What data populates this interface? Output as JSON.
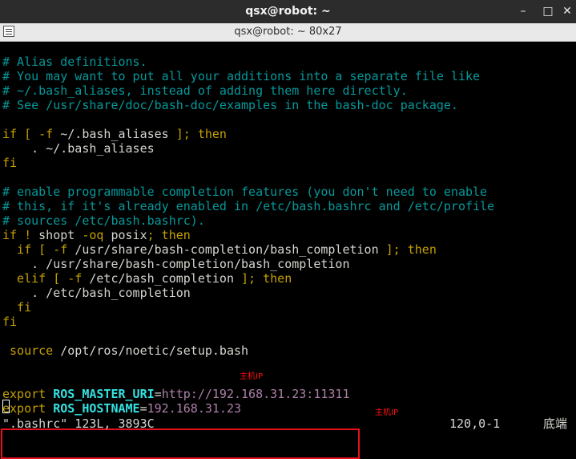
{
  "window": {
    "title": "qsx@robot: ~",
    "buttons": {
      "minimize": "–",
      "maximize": "□",
      "close": "✕"
    }
  },
  "tab": {
    "title": "qsx@robot: ~ 80x27"
  },
  "editor": {
    "lines": [
      {
        "parts": [
          {
            "t": "# Alias definitions.",
            "c": "comment"
          }
        ]
      },
      {
        "parts": [
          {
            "t": "# You may want to put all your additions into a separate file like",
            "c": "comment"
          }
        ]
      },
      {
        "parts": [
          {
            "t": "# ~/.bash_aliases, instead of adding them here directly.",
            "c": "comment"
          }
        ]
      },
      {
        "parts": [
          {
            "t": "# See /usr/share/doc/bash-doc/examples in the bash-doc package.",
            "c": "comment"
          }
        ]
      },
      {
        "parts": []
      },
      {
        "parts": [
          {
            "t": "if [ ",
            "c": "kw"
          },
          {
            "t": "-f ",
            "c": "kw"
          },
          {
            "t": "~/.bash_aliases",
            "c": "path"
          },
          {
            "t": " ]; then",
            "c": "kw"
          }
        ]
      },
      {
        "parts": [
          {
            "t": "    . ~/.bash_aliases",
            "c": "path"
          }
        ]
      },
      {
        "parts": [
          {
            "t": "fi",
            "c": "kw"
          }
        ]
      },
      {
        "parts": []
      },
      {
        "parts": [
          {
            "t": "# enable programmable completion features (you don't need to enable",
            "c": "comment"
          }
        ]
      },
      {
        "parts": [
          {
            "t": "# this, if it's already enabled in /etc/bash.bashrc and /etc/profile",
            "c": "comment"
          }
        ]
      },
      {
        "parts": [
          {
            "t": "# sources /etc/bash.bashrc).",
            "c": "comment"
          }
        ]
      },
      {
        "parts": [
          {
            "t": "if ! ",
            "c": "kw"
          },
          {
            "t": "shopt ",
            "c": "path"
          },
          {
            "t": "-oq ",
            "c": "kw"
          },
          {
            "t": "posix",
            "c": "path"
          },
          {
            "t": "; then",
            "c": "kw"
          }
        ]
      },
      {
        "parts": [
          {
            "t": "  if [ -f ",
            "c": "kw"
          },
          {
            "t": "/usr/share/bash-completion/bash_completion",
            "c": "path"
          },
          {
            "t": " ]; then",
            "c": "kw"
          }
        ]
      },
      {
        "parts": [
          {
            "t": "    . /usr/share/bash-completion/bash_completion",
            "c": "path"
          }
        ]
      },
      {
        "parts": [
          {
            "t": "  elif [ -f ",
            "c": "kw"
          },
          {
            "t": "/etc/bash_completion",
            "c": "path"
          },
          {
            "t": " ]; then",
            "c": "kw"
          }
        ]
      },
      {
        "parts": [
          {
            "t": "    . /etc/bash_completion",
            "c": "path"
          }
        ]
      },
      {
        "parts": [
          {
            "t": "  fi",
            "c": "kw"
          }
        ]
      },
      {
        "parts": [
          {
            "t": "fi",
            "c": "kw"
          }
        ]
      },
      {
        "parts": []
      },
      {
        "parts": [
          {
            "t": " source ",
            "c": "kw"
          },
          {
            "t": "/opt/ros/noetic/setup.bash",
            "c": "path"
          }
        ]
      },
      {
        "parts": []
      },
      {
        "parts": []
      },
      {
        "parts": [
          {
            "t": "export ",
            "c": "kw"
          },
          {
            "t": "ROS_MASTER_URI",
            "c": "var"
          },
          {
            "t": "=",
            "c": "path"
          },
          {
            "t": "http://192.168.31.23:11311",
            "c": "val"
          }
        ]
      },
      {
        "parts": [
          {
            "t": "export ",
            "c": "kw"
          },
          {
            "t": "ROS_HOSTNAME",
            "c": "var"
          },
          {
            "t": "=",
            "c": "path"
          },
          {
            "t": "192.168.31.23",
            "c": "val"
          }
        ]
      }
    ]
  },
  "annotations": {
    "top": "主机IP",
    "bottom": "主机IP"
  },
  "status": {
    "file_info": "\".bashrc\" 123L, 3893C",
    "position": "120,0-1",
    "scroll": "底端"
  },
  "colors": {
    "comment": "#06989a",
    "keyword": "#c4a000",
    "variable": "#34e2e2",
    "value": "#ad7fa8",
    "highlight_box": "#e8101a"
  }
}
